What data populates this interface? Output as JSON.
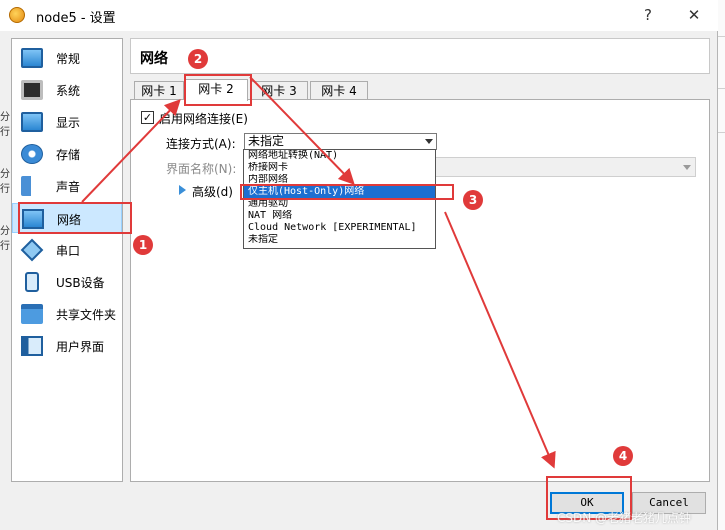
{
  "window": {
    "title": "node5 - 设置",
    "help": "?",
    "close": "✕"
  },
  "sidebar": {
    "items": [
      {
        "label": "常规",
        "icon": "general-icon"
      },
      {
        "label": "系统",
        "icon": "system-chip-icon"
      },
      {
        "label": "显示",
        "icon": "display-monitor-icon"
      },
      {
        "label": "存储",
        "icon": "storage-disc-icon"
      },
      {
        "label": "声音",
        "icon": "audio-speaker-icon"
      },
      {
        "label": "网络",
        "icon": "network-icon",
        "selected": true
      },
      {
        "label": "串口",
        "icon": "serial-port-icon"
      },
      {
        "label": "USB设备",
        "icon": "usb-icon"
      },
      {
        "label": "共享文件夹",
        "icon": "shared-folder-icon"
      },
      {
        "label": "用户界面",
        "icon": "user-interface-icon"
      }
    ]
  },
  "main": {
    "title": "网络",
    "tabs": [
      "网卡 1",
      "网卡 2",
      "网卡 3",
      "网卡 4"
    ],
    "active_tab": "网卡 2",
    "enable_label": "启用网络连接(E)",
    "enable_checked": true,
    "attach_label": "连接方式(A):",
    "attach_value": "未指定",
    "name_label": "界面名称(N):",
    "advanced_label": "高级(d)"
  },
  "dropdown": {
    "options": [
      "网络地址转换(NAT)",
      "桥接网卡",
      "内部网络",
      "仅主机(Host-Only)网络",
      "通用驱动",
      "NAT 网络",
      "Cloud Network [EXPERIMENTAL]",
      "未指定"
    ],
    "highlighted": "仅主机(Host-Only)网络"
  },
  "buttons": {
    "ok": "OK",
    "cancel": "Cancel"
  },
  "annotations": {
    "b1": "1",
    "b2": "2",
    "b3": "3",
    "b4": "4"
  },
  "left_strip": [
    "分",
    "行",
    "分",
    "行",
    "分",
    "行"
  ],
  "watermark": "CSDN @老猪老猪几点钟",
  "colors": {
    "annotation": "#e03a3a",
    "selection": "#1c6fd1",
    "default_button_border": "#0078d7"
  }
}
